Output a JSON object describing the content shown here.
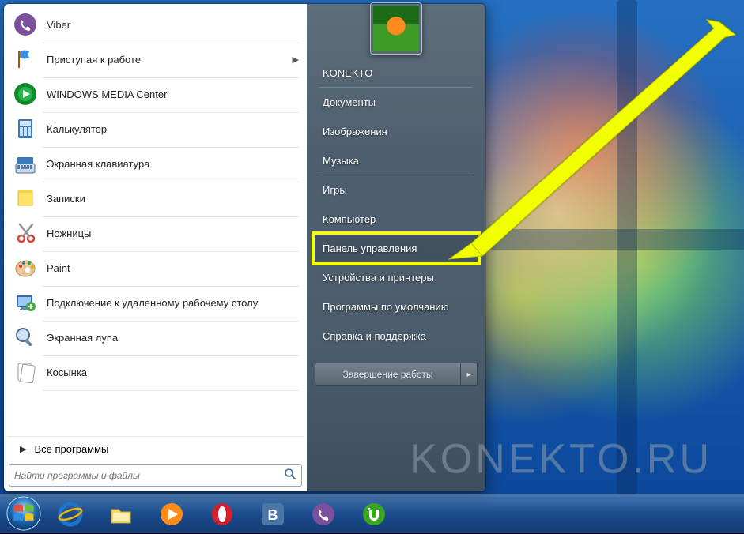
{
  "programs": [
    {
      "label": "Viber",
      "icon": "viber",
      "has_submenu": false
    },
    {
      "label": "Приступая к работе",
      "icon": "flag",
      "has_submenu": true
    },
    {
      "label": "WINDOWS MEDIA Center",
      "icon": "wmc",
      "has_submenu": false
    },
    {
      "label": "Калькулятор",
      "icon": "calc",
      "has_submenu": false
    },
    {
      "label": "Экранная клавиатура",
      "icon": "keyboard",
      "has_submenu": false
    },
    {
      "label": "Записки",
      "icon": "notes",
      "has_submenu": false
    },
    {
      "label": "Ножницы",
      "icon": "snip",
      "has_submenu": false
    },
    {
      "label": "Paint",
      "icon": "paint",
      "has_submenu": false
    },
    {
      "label": "Подключение к удаленному рабочему столу",
      "icon": "rdp",
      "has_submenu": false
    },
    {
      "label": "Экранная лупа",
      "icon": "magnifier",
      "has_submenu": false
    },
    {
      "label": "Косынка",
      "icon": "solitaire",
      "has_submenu": false
    }
  ],
  "all_programs_label": "Все программы",
  "search_placeholder": "Найти программы и файлы",
  "right_panel": {
    "user_name": "KONEKTO",
    "items": [
      {
        "label": "Документы"
      },
      {
        "label": "Изображения"
      },
      {
        "label": "Музыка",
        "sep_after": true
      },
      {
        "label": "Игры"
      },
      {
        "label": "Компьютер",
        "sep_after": true
      },
      {
        "label": "Панель управления",
        "highlight": true
      },
      {
        "label": "Устройства и принтеры"
      },
      {
        "label": "Программы по умолчанию"
      },
      {
        "label": "Справка и поддержка"
      }
    ]
  },
  "shutdown_label": "Завершение работы",
  "taskbar": {
    "items": [
      {
        "name": "ie",
        "title": "Internet Explorer"
      },
      {
        "name": "explorer",
        "title": "Проводник"
      },
      {
        "name": "wmp",
        "title": "Windows Media Player"
      },
      {
        "name": "opera",
        "title": "Opera"
      },
      {
        "name": "vk",
        "title": "VK"
      },
      {
        "name": "viber",
        "title": "Viber"
      },
      {
        "name": "utorrent",
        "title": "µTorrent"
      }
    ]
  },
  "watermark_text": "KONEKTO.RU"
}
